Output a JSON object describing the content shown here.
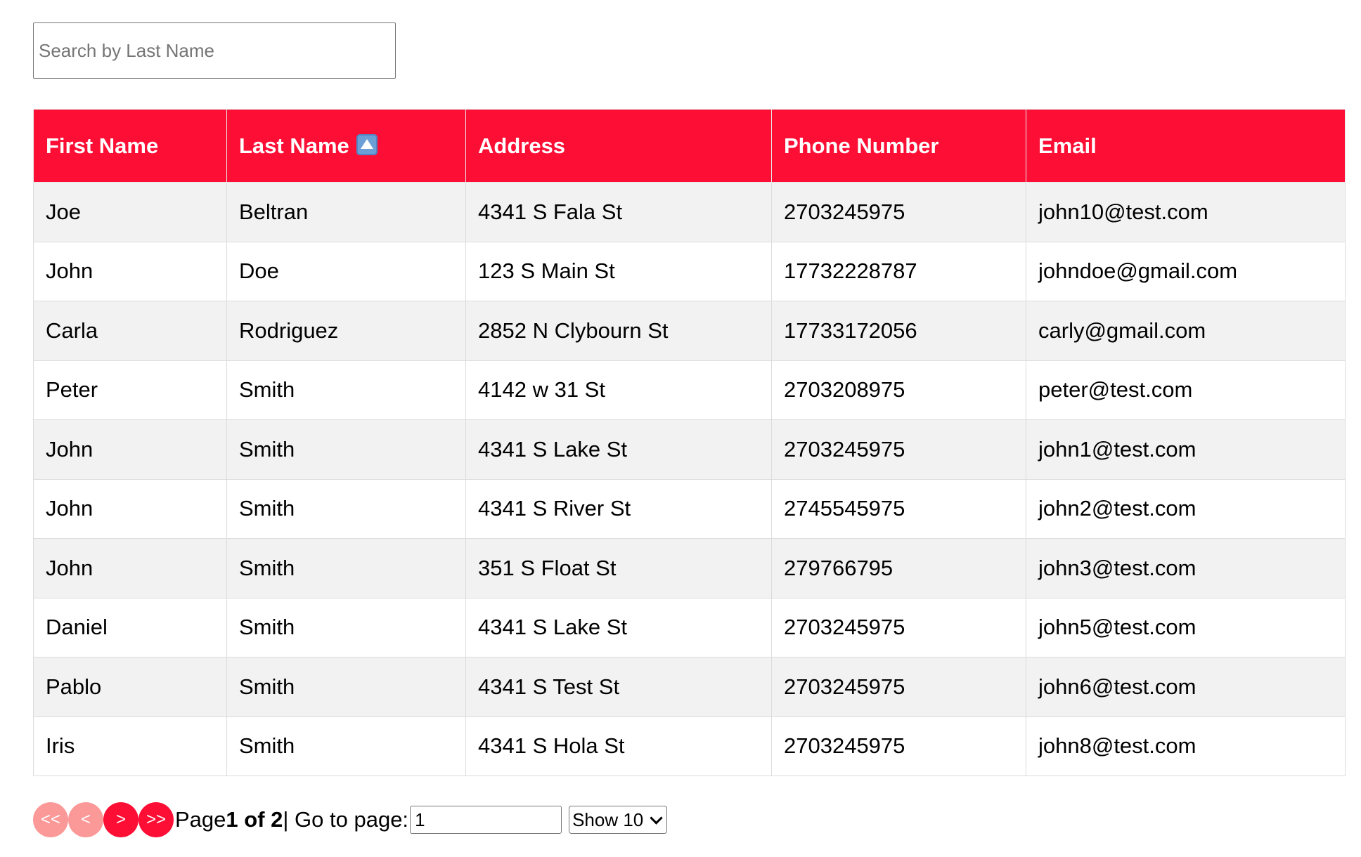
{
  "search": {
    "placeholder": "Search by Last Name",
    "value": ""
  },
  "table": {
    "columns": [
      "First Name",
      "Last Name",
      "Address",
      "Phone Number",
      "Email"
    ],
    "sorted_column": "Last Name",
    "sort_direction": "ascending",
    "rows": [
      [
        "Joe",
        "Beltran",
        "4341 S Fala St",
        "2703245975",
        "john10@test.com"
      ],
      [
        "John",
        "Doe",
        "123 S Main St",
        "17732228787",
        "johndoe@gmail.com"
      ],
      [
        "Carla",
        "Rodriguez",
        "2852 N Clybourn St",
        "17733172056",
        "carly@gmail.com"
      ],
      [
        "Peter",
        "Smith",
        "4142 w 31 St",
        "2703208975",
        "peter@test.com"
      ],
      [
        "John",
        "Smith",
        "4341 S Lake St",
        "2703245975",
        "john1@test.com"
      ],
      [
        "John",
        "Smith",
        "4341 S River St",
        "2745545975",
        "john2@test.com"
      ],
      [
        "John",
        "Smith",
        "351 S Float St",
        "279766795",
        "john3@test.com"
      ],
      [
        "Daniel",
        "Smith",
        "4341 S Lake St",
        "2703245975",
        "john5@test.com"
      ],
      [
        "Pablo",
        "Smith",
        "4341 S Test St",
        "2703245975",
        "john6@test.com"
      ],
      [
        "Iris",
        "Smith",
        "4341 S Hola St",
        "2703245975",
        "john8@test.com"
      ]
    ]
  },
  "pagination": {
    "first_label": "<<",
    "prev_label": "<",
    "next_label": ">",
    "last_label": ">>",
    "page_label": "Page",
    "page_info": "1 of 2",
    "separator_goto": "| Go to page:",
    "goto_value": "1",
    "show_label": "Show 10",
    "show_options": [
      "Show 10"
    ]
  },
  "colors": {
    "header_bg": "#fd0e35",
    "button_enabled": "#fd0e35",
    "button_disabled": "#fb9898",
    "row_stripe": "#f2f2f2"
  }
}
